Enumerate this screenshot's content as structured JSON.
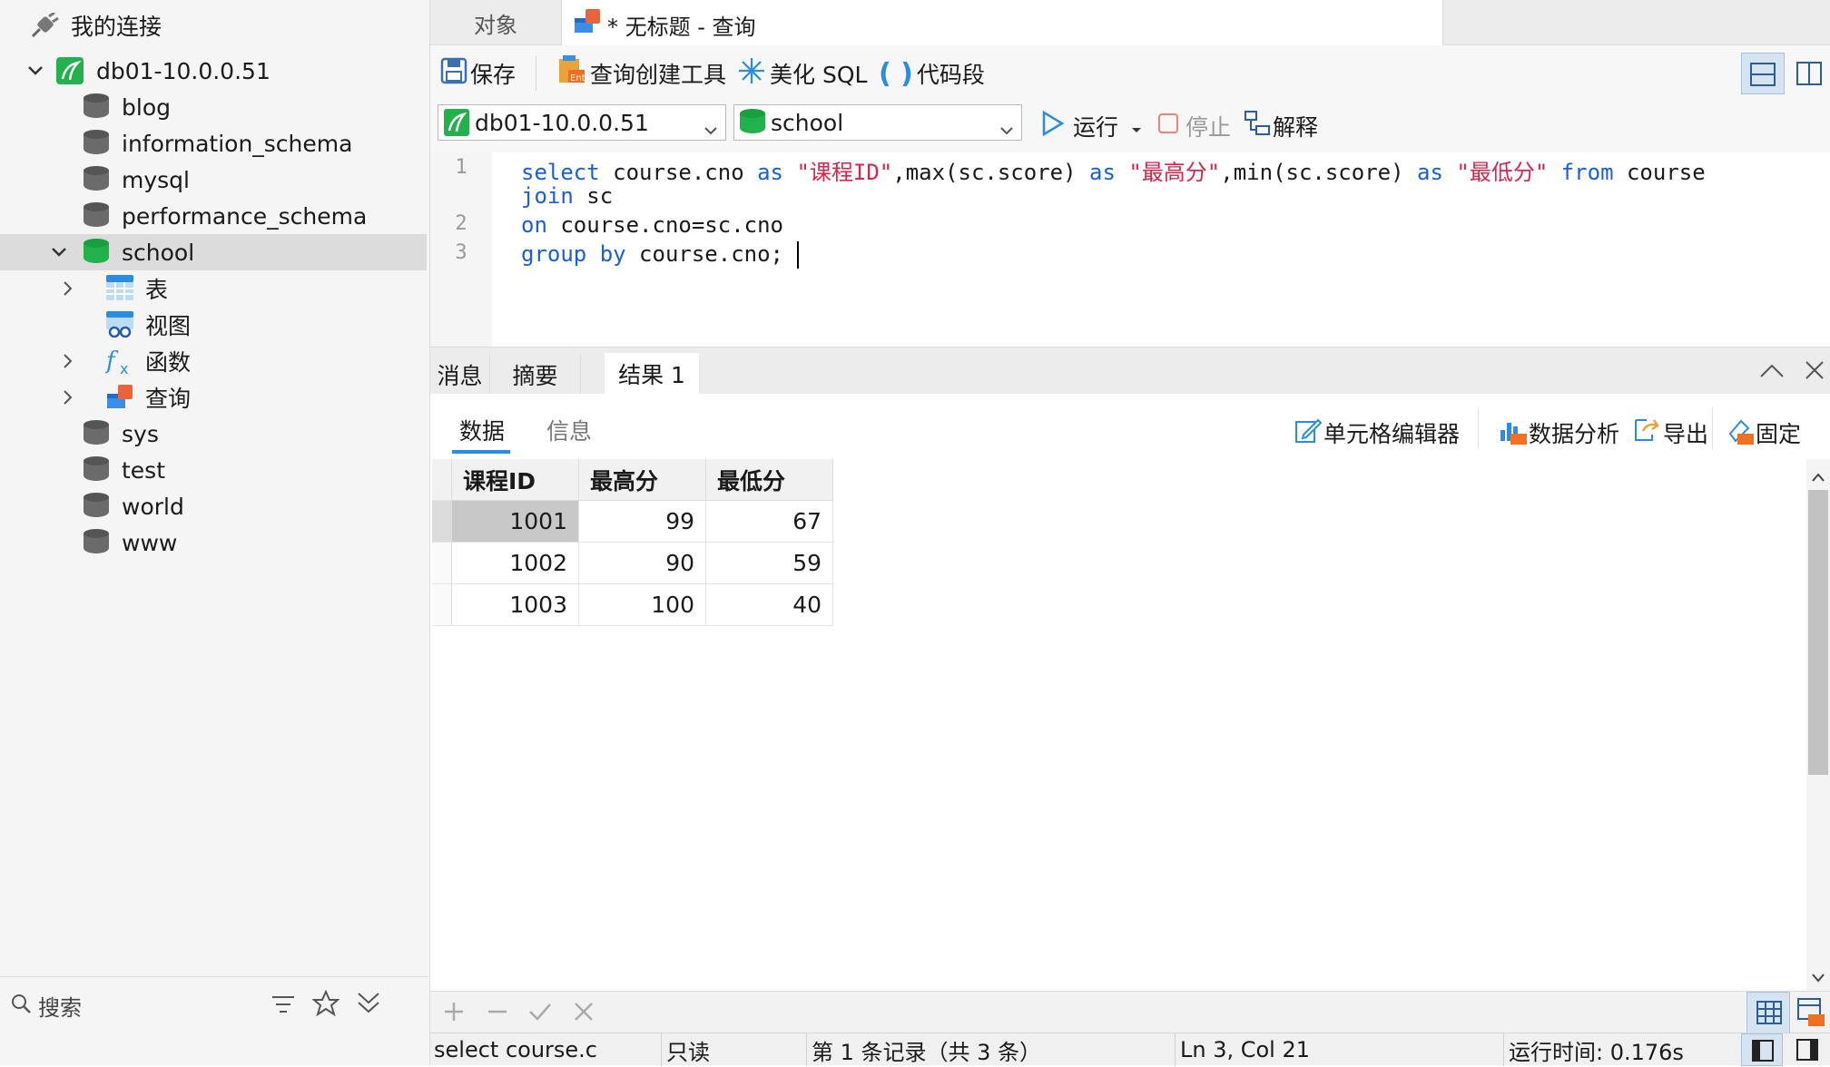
{
  "sidebar": {
    "title": "我的连接",
    "connection": "db01-10.0.0.51",
    "databases": [
      "blog",
      "information_schema",
      "mysql",
      "performance_schema",
      "school",
      "sys",
      "test",
      "world",
      "www"
    ],
    "school_children": [
      "表",
      "视图",
      "函数",
      "查询"
    ],
    "search_placeholder": "搜索"
  },
  "tabs": {
    "objects": "对象",
    "query": "* 无标题 - 查询"
  },
  "toolbar": {
    "save": "保存",
    "query_builder": "查询创建工具",
    "beautify": "美化 SQL",
    "snippet": "代码段",
    "connection_combo": "db01-10.0.0.51",
    "database_combo": "school",
    "run": "运行",
    "stop": "停止",
    "explain": "解释"
  },
  "editor": {
    "line_numbers": [
      "1",
      "2",
      "3"
    ],
    "lines": [
      [
        [
          "kw",
          "select"
        ],
        [
          "t",
          " course.cno "
        ],
        [
          "kw",
          "as"
        ],
        [
          "t",
          " "
        ],
        [
          "str",
          "\"课程ID\""
        ],
        [
          "t",
          ",max(sc.score) "
        ],
        [
          "kw",
          "as"
        ],
        [
          "t",
          " "
        ],
        [
          "str",
          "\"最高分\""
        ],
        [
          "t",
          ",min(sc.score) "
        ],
        [
          "kw",
          "as"
        ],
        [
          "t",
          " "
        ],
        [
          "str",
          "\"最低分\""
        ],
        [
          "t",
          " "
        ],
        [
          "kw",
          "from"
        ],
        [
          "t",
          " course"
        ]
      ],
      [
        [
          "kw",
          "join"
        ],
        [
          "t",
          " sc"
        ]
      ],
      [
        [
          "kw",
          "on"
        ],
        [
          "t",
          " course.cno=sc.cno"
        ]
      ],
      [
        [
          "kw",
          "group by"
        ],
        [
          "t",
          " course.cno;"
        ]
      ]
    ]
  },
  "result_tabs": [
    "消息",
    "摘要",
    "结果 1"
  ],
  "result_subtabs": [
    "数据",
    "信息"
  ],
  "result_tools": {
    "cell_editor": "单元格编辑器",
    "analysis": "数据分析",
    "export": "导出",
    "pin": "固定"
  },
  "grid": {
    "columns": [
      "课程ID",
      "最高分",
      "最低分"
    ],
    "rows": [
      [
        "1001",
        "99",
        "67"
      ],
      [
        "1002",
        "90",
        "59"
      ],
      [
        "1003",
        "100",
        "40"
      ]
    ]
  },
  "status": {
    "sql": "select course.cno a",
    "mode": "只读",
    "records": "第 1 条记录（共 3 条）",
    "cursor": "Ln 3, Col 21",
    "elapsed": "运行时间: 0.176s"
  },
  "colors": {
    "accent": "#1a5fd6",
    "string": "#d6264a",
    "db_green": "#22b14c",
    "db_gray": "#6b6b6b"
  }
}
